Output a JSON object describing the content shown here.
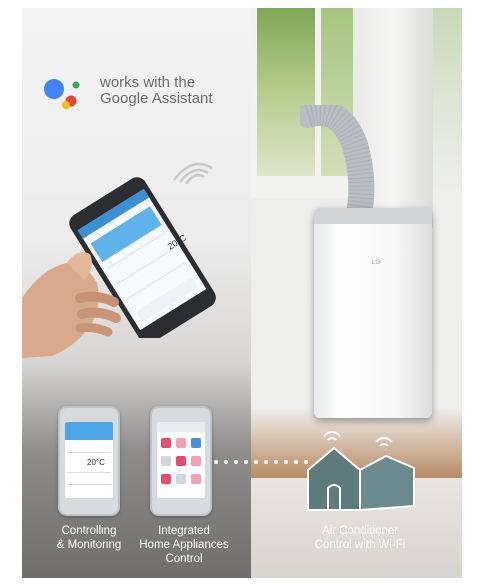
{
  "assistant": {
    "line1": "works with the",
    "line2": "Google Assistant"
  },
  "phone": {
    "temperature": "20°C"
  },
  "device_small": {
    "temperature": "20°C"
  },
  "features": [
    {
      "label_line1": "Controlling",
      "label_line2": "& Monitoring"
    },
    {
      "label_line1": "Integrated",
      "label_line2": "Home Appliances",
      "label_line3": "Control"
    },
    {
      "label_line1": "Air Conditioner",
      "label_line2": "Control with Wi-Fi"
    }
  ],
  "ac": {
    "logo": "LG"
  },
  "colors": {
    "google_blue": "#4285F4",
    "google_red": "#EA4335",
    "google_yellow": "#FBBC05",
    "google_green": "#34A853",
    "app_blue": "#4aa6e6"
  }
}
